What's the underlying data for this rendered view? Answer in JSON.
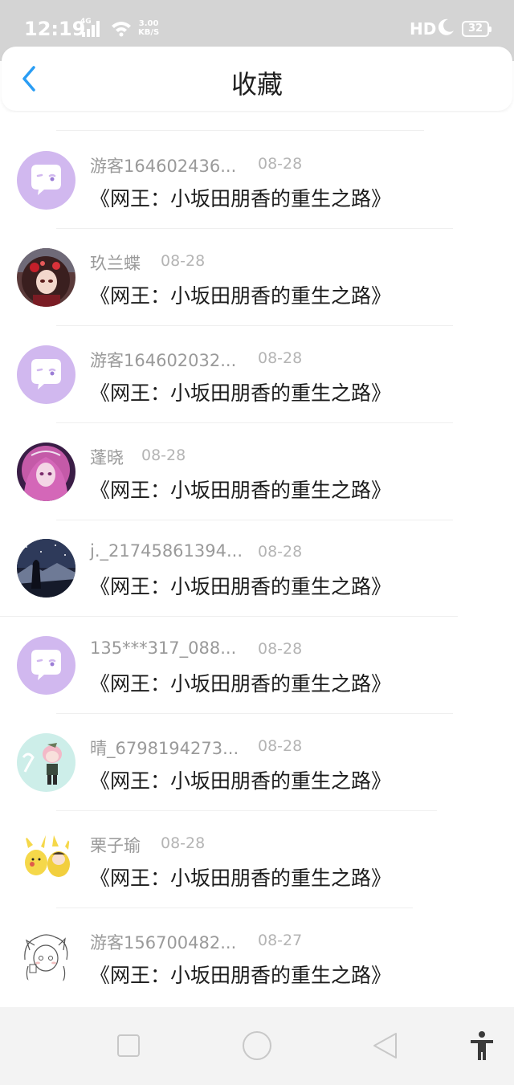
{
  "status_bar": {
    "time": "12:19",
    "network": "4G",
    "speed_value": "3.00",
    "speed_unit": "KB/S",
    "hd": "HD",
    "battery": "32",
    "icons": [
      "signal-icon",
      "wifi-icon",
      "moon-icon",
      "battery-icon"
    ]
  },
  "header": {
    "title": "收藏",
    "back_icon": "chevron-left-icon"
  },
  "colors": {
    "accent": "#2a9df4",
    "default_avatar_bg": "#d1b8ef",
    "status_bar_bg": "#d4d4d4"
  },
  "items": [
    {
      "username": "游客164602436...",
      "date": "08-28",
      "title": "《网王：小坂田朋香的重生之路》",
      "avatar": "default-chat-avatar"
    },
    {
      "username": "玖兰蝶",
      "date": "08-28",
      "title": "《网王：小坂田朋香的重生之路》",
      "avatar": "anime-girl-red-avatar"
    },
    {
      "username": "游客164602032...",
      "date": "08-28",
      "title": "《网王：小坂田朋香的重生之路》",
      "avatar": "default-chat-avatar"
    },
    {
      "username": "蓬晓",
      "date": "08-28",
      "title": "《网王：小坂田朋香的重生之路》",
      "avatar": "anime-girl-pink-avatar"
    },
    {
      "username": "j._21745861394...",
      "date": "08-28",
      "title": "《网王：小坂田朋香的重生之路》",
      "avatar": "night-sky-avatar"
    },
    {
      "username": "135***317_088...",
      "date": "08-28",
      "title": "《网王：小坂田朋香的重生之路》",
      "avatar": "default-chat-avatar"
    },
    {
      "username": "晴_6798194273...",
      "date": "08-28",
      "title": "《网王：小坂田朋香的重生之路》",
      "avatar": "chibi-leo-avatar"
    },
    {
      "username": "栗子瑜",
      "date": "08-28",
      "title": "《网王：小坂田朋香的重生之路》",
      "avatar": "pikachu-avatar"
    },
    {
      "username": "游客156700482...",
      "date": "08-27",
      "title": "《网王：小坂田朋香的重生之路》",
      "avatar": "sketch-girl-avatar"
    }
  ],
  "nav_bar": {
    "icons": [
      "recent-apps-icon",
      "home-icon",
      "back-icon",
      "accessibility-icon"
    ]
  }
}
